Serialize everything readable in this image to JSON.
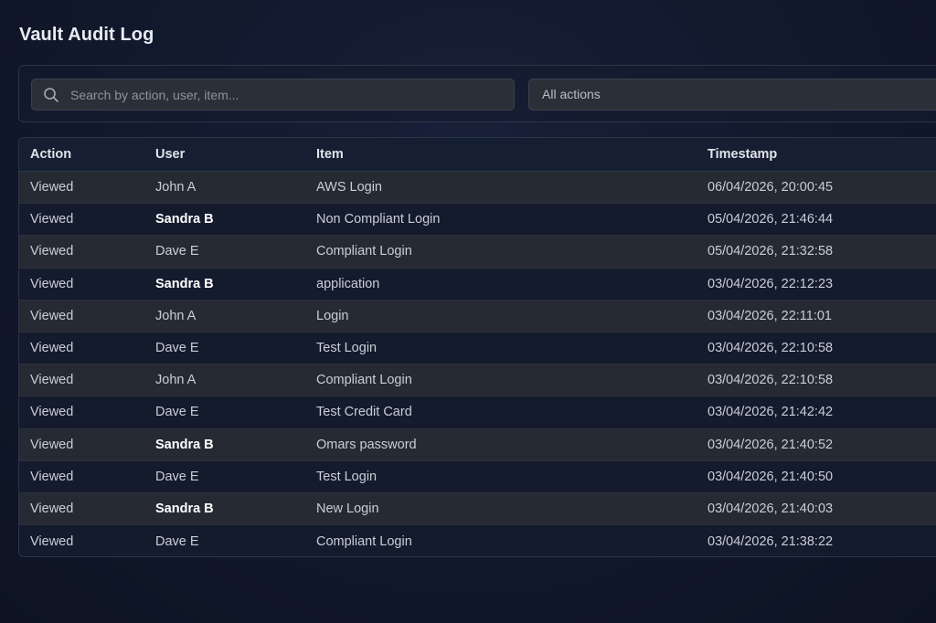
{
  "page": {
    "title": "Vault Audit Log"
  },
  "filters": {
    "search_placeholder": "Search by action, user, item...",
    "action_select_value": "All actions"
  },
  "table": {
    "columns": [
      "Action",
      "User",
      "Item",
      "Timestamp"
    ],
    "rows": [
      {
        "action": "Viewed",
        "user": "John A",
        "item": "AWS Login",
        "timestamp": "06/04/2026, 20:00:45"
      },
      {
        "action": "Viewed",
        "user": "Sandra B",
        "item": "Non Compliant Login",
        "timestamp": "05/04/2026, 21:46:44"
      },
      {
        "action": "Viewed",
        "user": "Dave E",
        "item": "Compliant Login",
        "timestamp": "05/04/2026, 21:32:58"
      },
      {
        "action": "Viewed",
        "user": "Sandra B",
        "item": "application",
        "timestamp": "03/04/2026, 22:12:23"
      },
      {
        "action": "Viewed",
        "user": "John A",
        "item": "Login",
        "timestamp": "03/04/2026, 22:11:01"
      },
      {
        "action": "Viewed",
        "user": "Dave E",
        "item": "Test Login",
        "timestamp": "03/04/2026, 22:10:58"
      },
      {
        "action": "Viewed",
        "user": "John A",
        "item": "Compliant Login",
        "timestamp": "03/04/2026, 22:10:58"
      },
      {
        "action": "Viewed",
        "user": "Dave E",
        "item": "Test Credit Card",
        "timestamp": "03/04/2026, 21:42:42"
      },
      {
        "action": "Viewed",
        "user": "Sandra B",
        "item": "Omars password",
        "timestamp": "03/04/2026, 21:40:52"
      },
      {
        "action": "Viewed",
        "user": "Dave E",
        "item": "Test Login",
        "timestamp": "03/04/2026, 21:40:50"
      },
      {
        "action": "Viewed",
        "user": "Sandra B",
        "item": "New Login",
        "timestamp": "03/04/2026, 21:40:03"
      },
      {
        "action": "Viewed",
        "user": "Dave E",
        "item": "Compliant Login",
        "timestamp": "03/04/2026, 21:38:22"
      }
    ]
  },
  "icons": {
    "search": "search-icon"
  },
  "colors": {
    "background": "#121a2e",
    "row_alt": "#262a33",
    "row_plain": "#141b2d",
    "input_bg": "#2b2f38"
  }
}
